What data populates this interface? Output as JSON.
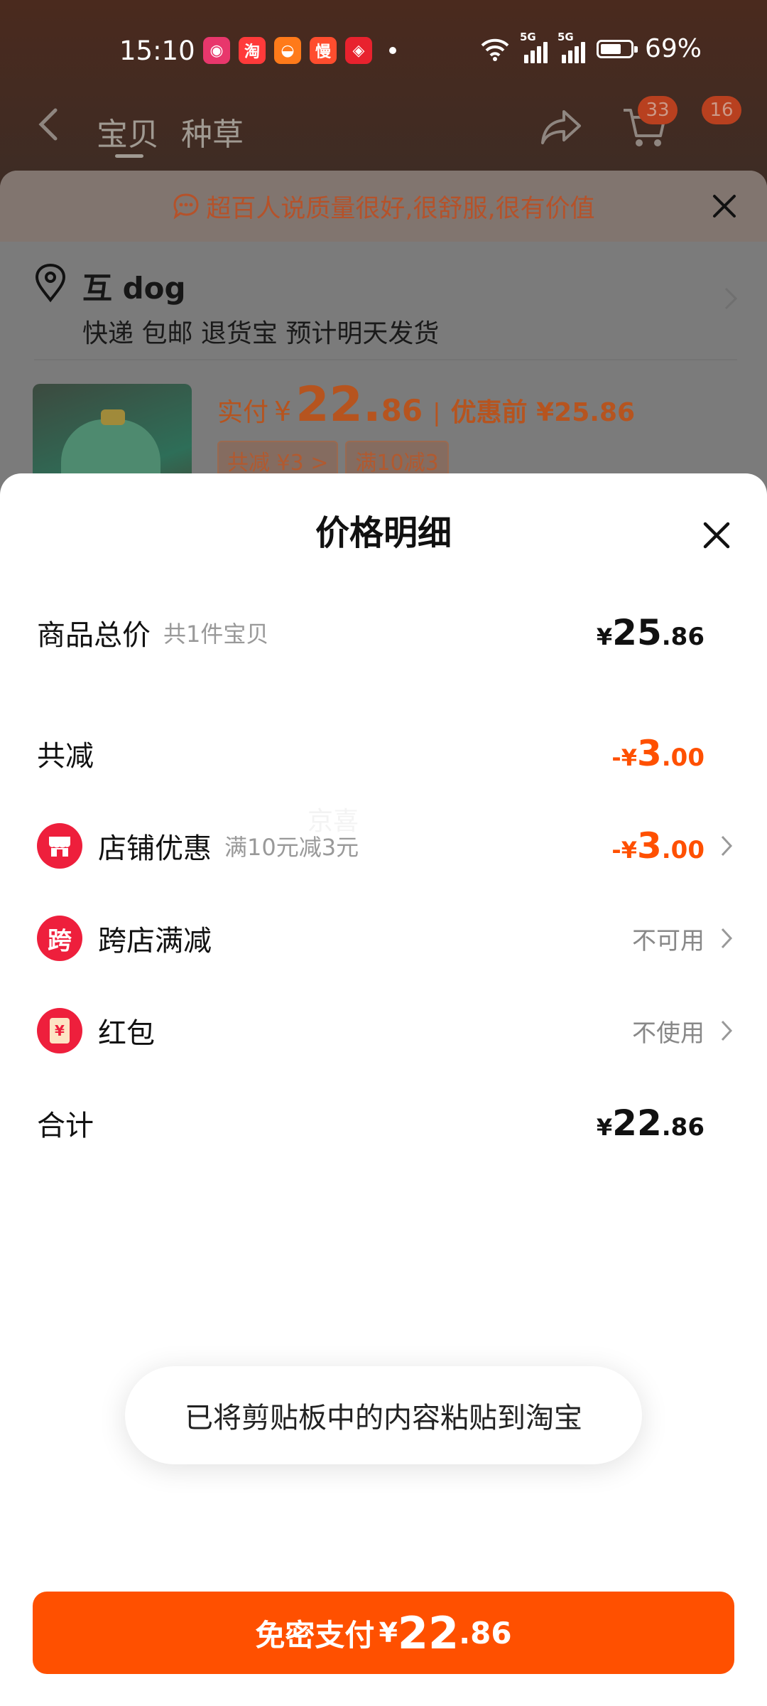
{
  "status_bar": {
    "time": "15:10",
    "battery_pct": "69%",
    "network": "5G",
    "battery_level": 0.69,
    "apps": [
      {
        "name": "app-1-icon",
        "glyph": "◉",
        "color": "#e8376c"
      },
      {
        "name": "taobao-app-icon",
        "glyph": "淘",
        "color": "#ff3a3a"
      },
      {
        "name": "app-3-icon",
        "glyph": "◒",
        "color": "#ff7a1a"
      },
      {
        "name": "app-4-icon",
        "glyph": "慢",
        "color": "#ff4d2e"
      },
      {
        "name": "app-5-icon",
        "glyph": "◈",
        "color": "#e8222e"
      }
    ]
  },
  "top_nav": {
    "tab_a": "宝贝",
    "tab_b": "种草",
    "cart_badge": "33",
    "msg_badge": "16"
  },
  "order": {
    "tip": "超百人说质量很好,很舒服,很有价值",
    "address_name": "互 dog",
    "address_info": "快递 包邮 退货宝 预计明天发货",
    "pay_label": "实付",
    "pay_yen": "¥",
    "pay_int": "22.",
    "pay_dec": "86",
    "pay_sep": "|",
    "pay_before": "优惠前 ¥25.86",
    "tags": [
      "共减 ¥3 >",
      "满10减3"
    ]
  },
  "modal": {
    "title": "价格明细",
    "rows": {
      "total": {
        "label": "商品总价",
        "note": "共1件宝贝",
        "yen": "¥",
        "int": "25",
        "dec": ".86"
      },
      "discount": {
        "label": "共减",
        "yen": "-¥",
        "int": "3",
        "dec": ".00"
      },
      "shop": {
        "label": "店铺优惠",
        "note": "满10元减3元",
        "icon": "店",
        "yen": "-¥",
        "int": "3",
        "dec": ".00"
      },
      "cross": {
        "label": "跨店满减",
        "icon": "跨",
        "status": "不可用"
      },
      "redpacket": {
        "label": "红包",
        "icon": "¥",
        "status": "不使用"
      },
      "sum": {
        "label": "合计",
        "yen": "¥",
        "int": "22",
        "dec": ".86"
      }
    },
    "watermark": "京喜"
  },
  "toast": "已将剪贴板中的内容粘贴到淘宝",
  "pay_button": {
    "label": "免密支付",
    "yen": "¥",
    "int": "22",
    "dec": ".86"
  },
  "colors": {
    "accent": "#ff5000",
    "red": "#ee1f3c"
  }
}
